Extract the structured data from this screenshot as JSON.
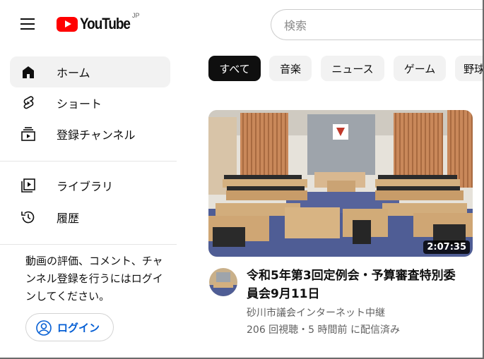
{
  "header": {
    "logo_text": "YouTube",
    "region": "JP",
    "search_placeholder": "検索"
  },
  "sidebar": {
    "items": [
      {
        "label": "ホーム",
        "icon": "home-icon",
        "active": true
      },
      {
        "label": "ショート",
        "icon": "shorts-icon"
      },
      {
        "label": "登録チャンネル",
        "icon": "subscriptions-icon"
      },
      {
        "label": "ライブラリ",
        "icon": "library-icon"
      },
      {
        "label": "履歴",
        "icon": "history-icon"
      }
    ],
    "signin_prompt": "動画の評価、コメント、チャンネル登録を行うにはログインしてください。",
    "signin_button": "ログイン"
  },
  "chips": [
    "すべて",
    "音楽",
    "ニュース",
    "ゲーム",
    "野球"
  ],
  "video": {
    "title": "令和5年第3回定例会・予算審査特別委員会9月11日",
    "channel": "砂川市議会インターネット中継",
    "meta": "206 回視聴・5 時間前 に配信済み",
    "duration": "2:07:35"
  },
  "colors": {
    "brand_red": "#ff0000",
    "link_blue": "#065fd4",
    "chip_bg": "#f2f2f2",
    "chip_active_bg": "#0f0f0f",
    "secondary_text": "#606060"
  }
}
